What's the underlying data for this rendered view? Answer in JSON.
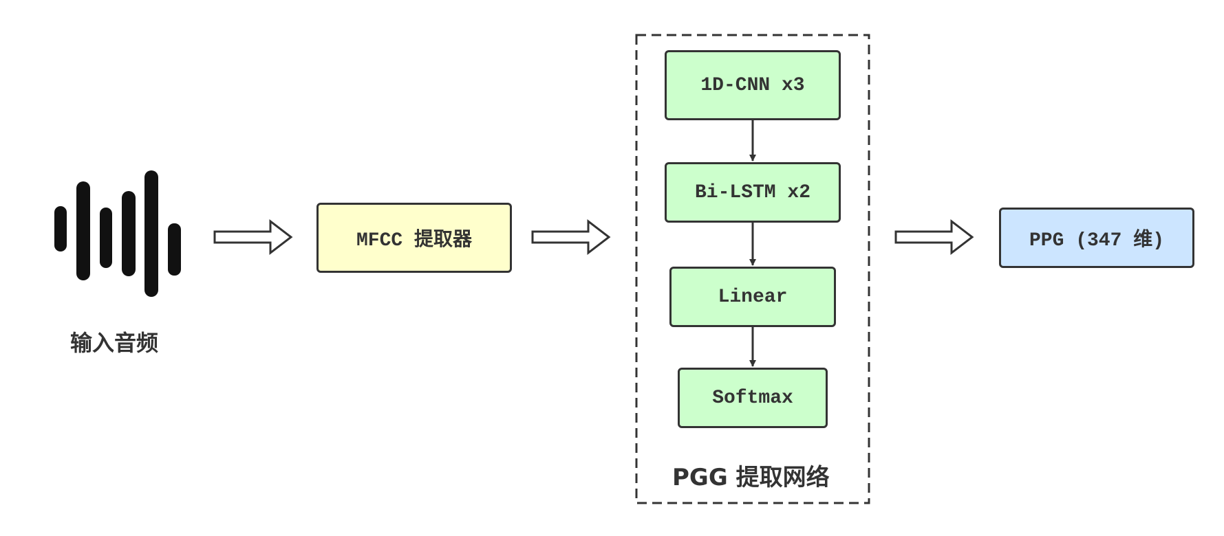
{
  "input": {
    "label": "输入音频"
  },
  "mfcc": {
    "label": "MFCC 提取器"
  },
  "network": {
    "title": "PGG 提取网络",
    "layers": [
      {
        "label": "1D-CNN x3"
      },
      {
        "label": "Bi-LSTM x2"
      },
      {
        "label": "Linear"
      },
      {
        "label": "Softmax"
      }
    ]
  },
  "output": {
    "label": "PPG (347 维)"
  },
  "colors": {
    "stroke": "#333333",
    "mfcc_fill": "#ffffcc",
    "layer_fill": "#ccffcc",
    "output_fill": "#cce5ff"
  }
}
